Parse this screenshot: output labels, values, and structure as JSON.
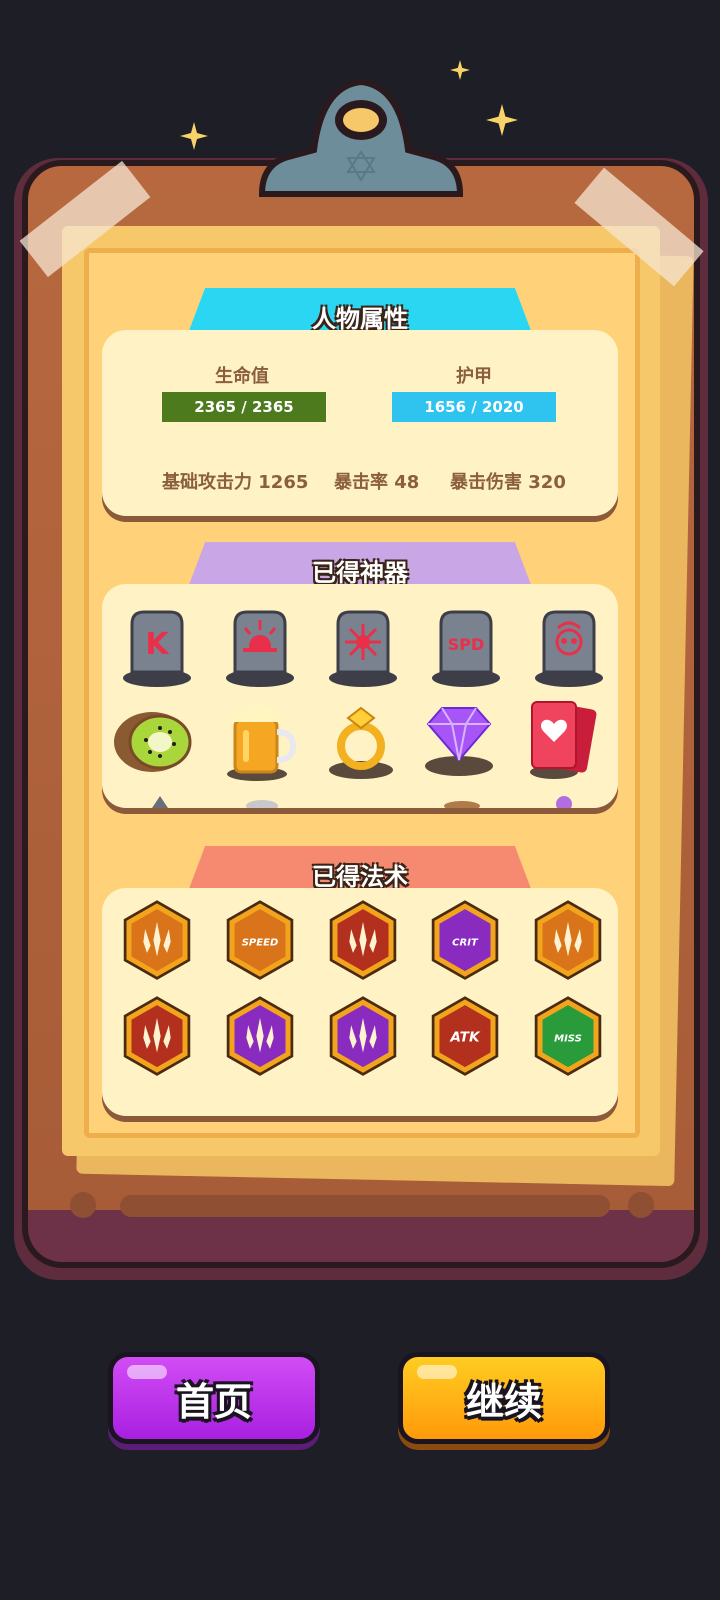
{
  "sections": {
    "attributes": {
      "title": "人物属性"
    },
    "artifacts": {
      "title": "已得神器"
    },
    "spells": {
      "title": "已得法术"
    }
  },
  "stats": {
    "hp": {
      "label": "生命值",
      "value_text": "2365 / 2365",
      "current": 2365,
      "max": 2365,
      "color": "#4e7a1e"
    },
    "armor": {
      "label": "护甲",
      "value_text": "1656 / 2020",
      "current": 1656,
      "max": 2020,
      "color": "#2fc3f0"
    },
    "base_attack": "基础攻击力 1265",
    "crit_rate": "暴击率 48",
    "crit_damage": "暴击伤害 320"
  },
  "artifacts": {
    "row1": [
      {
        "icon": "tombstone-k-rune-icon",
        "glyph": "K"
      },
      {
        "icon": "tombstone-sunrise-icon",
        "glyph": ""
      },
      {
        "icon": "tombstone-burst-icon",
        "glyph": ""
      },
      {
        "icon": "tombstone-spd-icon",
        "glyph": "SPD"
      },
      {
        "icon": "tombstone-skull-icon",
        "glyph": ""
      }
    ],
    "row2": [
      {
        "icon": "kiwi-icon"
      },
      {
        "icon": "beer-mug-icon"
      },
      {
        "icon": "gold-ring-icon"
      },
      {
        "icon": "purple-gem-icon"
      },
      {
        "icon": "heart-cards-icon"
      }
    ]
  },
  "spells": {
    "row1": [
      {
        "icon": "triple-spark-spell-icon",
        "glyph": "",
        "color": "#d9741a"
      },
      {
        "icon": "speed-spell-icon",
        "glyph": "SPEED",
        "color": "#d9741a"
      },
      {
        "icon": "fire-shield-spell-icon",
        "glyph": "",
        "color": "#b3301f"
      },
      {
        "icon": "crit-spell-icon",
        "glyph": "CRIT",
        "color": "#8a2bc0"
      },
      {
        "icon": "lightning-shield-spell-icon",
        "glyph": "",
        "color": "#d9741a"
      }
    ],
    "row2": [
      {
        "icon": "double-claw-spell-icon",
        "glyph": "",
        "color": "#b3301f"
      },
      {
        "icon": "shield-arrow-spell-icon",
        "glyph": "",
        "color": "#8a2bc0"
      },
      {
        "icon": "purple-claw-spell-icon",
        "glyph": "",
        "color": "#8a2bc0"
      },
      {
        "icon": "atk-spell-icon",
        "glyph": "ATK",
        "color": "#b3301f"
      },
      {
        "icon": "miss-spell-icon",
        "glyph": "MISS",
        "color": "#2a9b3a"
      }
    ]
  },
  "buttons": {
    "home": "首页",
    "continue": "继续"
  },
  "colors": {
    "background": "#1e1e26",
    "attributes_tab": "#2bd6f2",
    "artifacts_tab": "#c9a6e6",
    "spells_tab": "#f58a70",
    "home_button": "#b629e8",
    "continue_button": "#ffaa14"
  }
}
